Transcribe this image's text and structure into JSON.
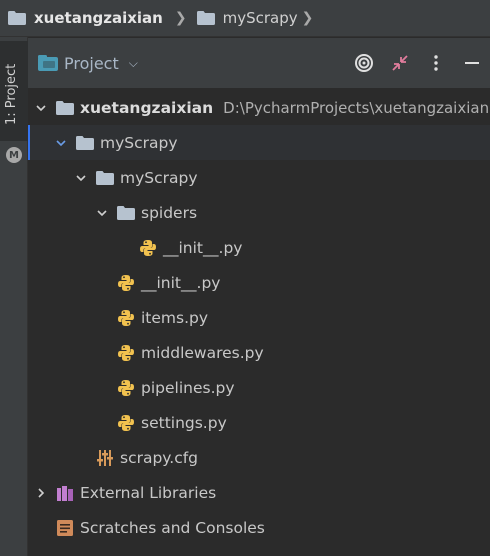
{
  "breadcrumb": {
    "items": [
      "xuetangzaixian",
      "myScrapy"
    ]
  },
  "sidebar": {
    "tab_label": "1: Project"
  },
  "toolwindow": {
    "title": "Project"
  },
  "tree": {
    "root": {
      "label": "xuetangzaixian",
      "path": "D:\\PycharmProjects\\xuetangzaixian"
    },
    "nodes": [
      "myScrapy",
      "myScrapy",
      "spiders",
      "__init__.py",
      "__init__.py",
      "items.py",
      "middlewares.py",
      "pipelines.py",
      "settings.py",
      "scrapy.cfg",
      "External Libraries",
      "Scratches and Consoles"
    ]
  },
  "colors": {
    "background": "#2b2b2b",
    "panel": "#3c3f41",
    "folder": "#b6c2cf",
    "python_blue": "#3d7ab8",
    "python_yellow": "#f2c24f",
    "accent": "#3574f0",
    "library": "#c27fd0",
    "scratch": "#d08a5a"
  }
}
